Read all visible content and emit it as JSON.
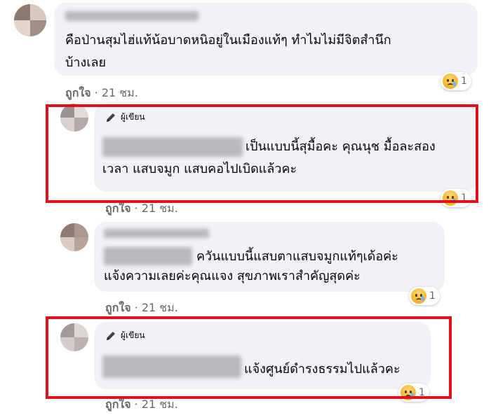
{
  "comments": [
    {
      "text_lines": [
        "คือป่านสุมไฮ่แท้น้อบาดหนิอยู่ในเมืองแท้ๆ ทำไมไม่มีจิตสำนึก",
        "บ้างเลย"
      ],
      "like_label": "ถูกใจ",
      "time": "21 ชม.",
      "reaction_count": "1"
    },
    {
      "author_badge": "ผู้เขียน",
      "text_lines": [
        "เป็นแบบนี้สุมื้อคะ คุณนุช มื้อละสอง",
        "เวลา แสบจมูก แสบคอไปเบิดแล้วคะ"
      ],
      "like_label": "ถูกใจ",
      "time": "21 ชม.",
      "reaction_count": "1"
    },
    {
      "text_lines": [
        "ควันแบบนี้แสบตาแสบจมูกแท้ๆเด้อค่ะ",
        "แจ้งความเลยค่ะคุณแจง สุขภาพเราสำคัญสุดค่ะ"
      ],
      "like_label": "ถูกใจ",
      "time": "21 ชม.",
      "reaction_count": "1"
    },
    {
      "author_badge": "ผู้เขียน",
      "text_lines": [
        "แจ้งศูนย์ดำรงธรรมไปแล้วคะ"
      ],
      "like_label": "ถูกใจ",
      "time": "21 ชม.",
      "reaction_count": "1"
    }
  ],
  "separator": "·",
  "colors": {
    "bubble": "#f0f2f5",
    "meta_text": "#65676b",
    "highlight_box": "#e0101c"
  },
  "icons": {
    "author_badge_icon": "pencil-icon",
    "reaction_icon": "sad-emoji-icon"
  }
}
